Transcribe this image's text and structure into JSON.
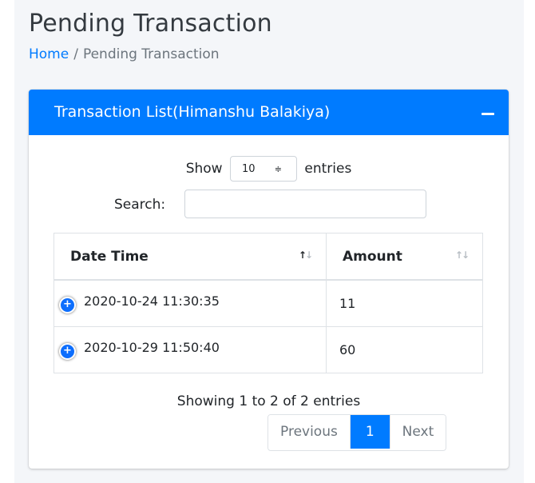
{
  "page": {
    "title": "Pending Transaction",
    "breadcrumb": {
      "home": "Home",
      "separator": "/",
      "current": "Pending Transaction"
    }
  },
  "card": {
    "title": "Transaction List(Himanshu Balakiya)",
    "collapse_icon": "minus-icon"
  },
  "table_controls": {
    "show_label": "Show",
    "entries_value": "10",
    "entries_arrows": "≑",
    "entries_label": "entries",
    "search_label": "Search:",
    "search_value": ""
  },
  "table": {
    "columns": [
      {
        "label": "Date Time",
        "sort": "active"
      },
      {
        "label": "Amount",
        "sort": "inactive"
      }
    ],
    "rows": [
      {
        "expand": "+",
        "date_time": "2020-10-24 11:30:35",
        "amount": "11"
      },
      {
        "expand": "+",
        "date_time": "2020-10-29 11:50:40",
        "amount": "60"
      }
    ]
  },
  "footer": {
    "info": "Showing 1 to 2 of 2 entries",
    "pagination": {
      "previous": "Previous",
      "current_page": "1",
      "next": "Next"
    }
  },
  "colors": {
    "primary": "#007bff",
    "background": "#f4f6f9",
    "text": "#212529",
    "muted": "#6c757d"
  }
}
